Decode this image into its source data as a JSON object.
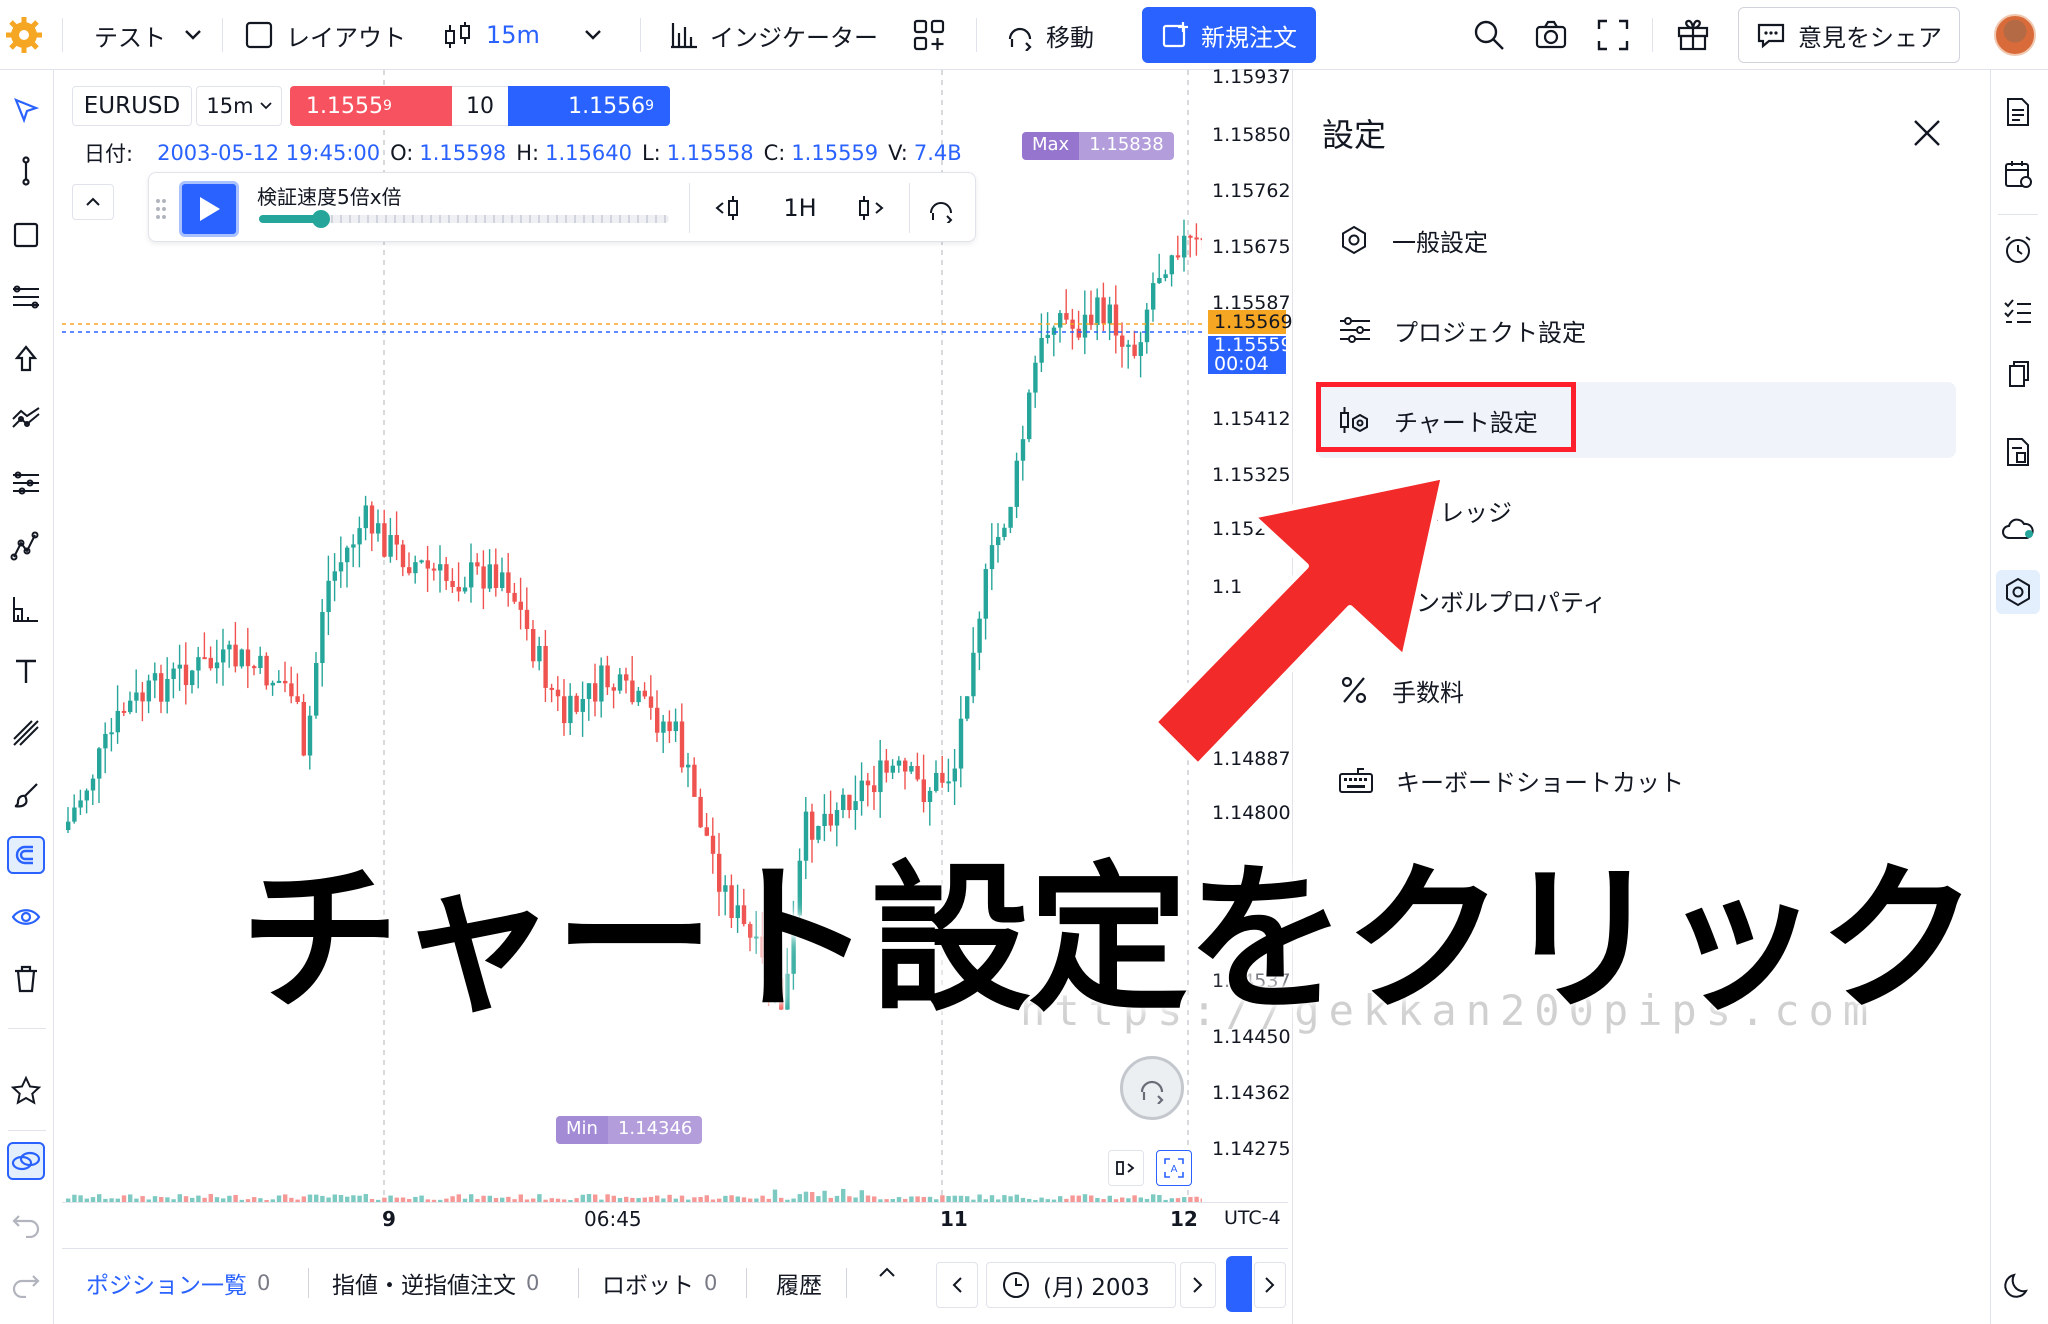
{
  "topbar": {
    "account": "テスト",
    "layout": "レイアウト",
    "timeframe": "15m",
    "indicators": "インジケーター",
    "move": "移動",
    "new_order": "新規注文",
    "feedback": "意見をシェア"
  },
  "chart": {
    "symbol": "EURUSD",
    "interval": "15m",
    "sell_price_main": "1.1555",
    "sell_price_sup": "9",
    "quantity": "10",
    "buy_price_main": "1.1556",
    "buy_price_sup": "9",
    "ohlc": {
      "date_label": "日付:",
      "date": "2003-05-12 19:45:00",
      "o_label": "O:",
      "o": "1.15598",
      "h_label": "H:",
      "h": "1.15640",
      "l_label": "L:",
      "l": "1.15558",
      "c_label": "C:",
      "c": "1.15559",
      "v_label": "V:",
      "v": "7.4B"
    },
    "replay": {
      "speed_label": "検証速度5倍x倍",
      "speed_fraction": 0.15,
      "interval": "1H"
    },
    "max_label": "Max",
    "max_value": "1.15838",
    "min_label": "Min",
    "min_value": "1.14346",
    "price_ticks": [
      "1.15937",
      "1.15850",
      "1.15762",
      "1.15675",
      "1.15587",
      "1.15412",
      "1.15325",
      "1.152",
      "1.1",
      "1.14887",
      "1.14800",
      "1.14537",
      "1.14450",
      "1.14362",
      "1.14275"
    ],
    "current_price_1": "1.15569",
    "current_price_2": "1.15559",
    "countdown": "00:04",
    "time_ticks": [
      "9",
      "06:45",
      "11",
      "12"
    ],
    "timezone": "UTC-4",
    "colors": {
      "up": "#26a69a",
      "down": "#ef5350",
      "accent": "#2962ff"
    }
  },
  "chart_data": {
    "type": "candlestick",
    "symbol": "EURUSD",
    "interval": "15m",
    "ylim": [
      1.14275,
      1.15937
    ],
    "max": 1.15838,
    "min": 1.14346,
    "last_close": 1.15559,
    "x_labels": [
      "9",
      "06:45",
      "11",
      "12"
    ]
  },
  "bottombar": {
    "positions": "ポジション一覧",
    "positions_count": "0",
    "orders": "指値・逆指値注文",
    "orders_count": "0",
    "robot": "ロボット",
    "robot_count": "0",
    "history": "履歴",
    "date_nav": "(月) 2003"
  },
  "settings": {
    "title": "設定",
    "items": [
      {
        "label": "一般設定",
        "icon": "hexagon-gear-icon"
      },
      {
        "label": "プロジェクト設定",
        "icon": "sliders-icon"
      },
      {
        "label": "チャート設定",
        "icon": "chart-gear-icon"
      },
      {
        "label": "レバレッジ",
        "icon": "leverage-icon"
      },
      {
        "label": "シンボルプロパティ",
        "icon": "symbol-icon"
      },
      {
        "label": "手数料",
        "icon": "percent-icon"
      },
      {
        "label": "キーボードショートカット",
        "icon": "keyboard-icon"
      }
    ]
  },
  "overlay": {
    "caption": "チャート設定をクリック",
    "watermark": "https://gekkan200pips.com"
  }
}
